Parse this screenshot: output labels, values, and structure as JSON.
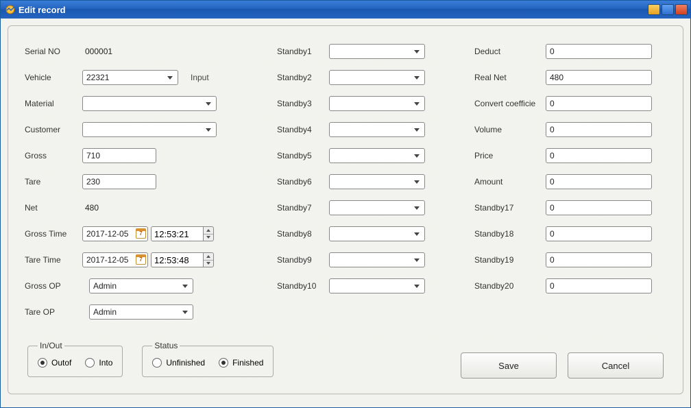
{
  "window": {
    "title": "Edit record"
  },
  "fields": {
    "serial_no": {
      "label": "Serial NO",
      "value": "000001"
    },
    "vehicle": {
      "label": "Vehicle",
      "value": "22321",
      "hint": "Input"
    },
    "material": {
      "label": "Material",
      "value": ""
    },
    "customer": {
      "label": "Customer",
      "value": ""
    },
    "gross": {
      "label": "Gross",
      "value": "710"
    },
    "tare": {
      "label": "Tare",
      "value": "230"
    },
    "net": {
      "label": "Net",
      "value": "480"
    },
    "gross_time": {
      "label": "Gross Time",
      "date": "2017-12-05",
      "time": "12:53:21"
    },
    "tare_time": {
      "label": "Tare Time",
      "date": "2017-12-05",
      "time": "12:53:48"
    },
    "gross_op": {
      "label": "Gross OP",
      "value": "Admin"
    },
    "tare_op": {
      "label": "Tare OP",
      "value": "Admin"
    },
    "standby1": {
      "label": "Standby1",
      "value": ""
    },
    "standby2": {
      "label": "Standby2",
      "value": ""
    },
    "standby3": {
      "label": "Standby3",
      "value": ""
    },
    "standby4": {
      "label": "Standby4",
      "value": ""
    },
    "standby5": {
      "label": "Standby5",
      "value": ""
    },
    "standby6": {
      "label": "Standby6",
      "value": ""
    },
    "standby7": {
      "label": "Standby7",
      "value": ""
    },
    "standby8": {
      "label": "Standby8",
      "value": ""
    },
    "standby9": {
      "label": "Standby9",
      "value": ""
    },
    "standby10": {
      "label": "Standby10",
      "value": ""
    },
    "deduct": {
      "label": "Deduct",
      "value": "0"
    },
    "real_net": {
      "label": "Real Net",
      "value": "480"
    },
    "convert_coeff": {
      "label": "Convert coefficie",
      "value": "0"
    },
    "volume": {
      "label": "Volume",
      "value": "0"
    },
    "price": {
      "label": "Price",
      "value": "0"
    },
    "amount": {
      "label": "Amount",
      "value": "0"
    },
    "standby17": {
      "label": "Standby17",
      "value": "0"
    },
    "standby18": {
      "label": "Standby18",
      "value": "0"
    },
    "standby19": {
      "label": "Standby19",
      "value": "0"
    },
    "standby20": {
      "label": "Standby20",
      "value": "0"
    }
  },
  "groups": {
    "inout": {
      "legend": "In/Out",
      "options": [
        "Outof",
        "Into"
      ],
      "selected": "Outof"
    },
    "status": {
      "legend": "Status",
      "options": [
        "Unfinished",
        "Finished"
      ],
      "selected": "Finished"
    }
  },
  "buttons": {
    "save": "Save",
    "cancel": "Cancel"
  },
  "date_icon_text": "7"
}
